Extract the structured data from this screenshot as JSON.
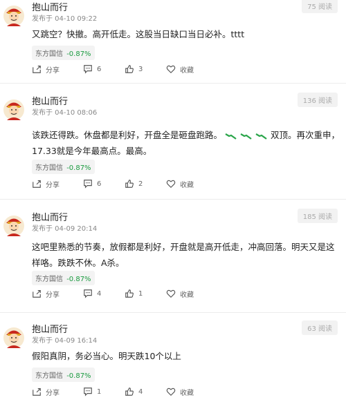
{
  "posts": [
    {
      "author": "抱山而行",
      "time": "发布于 04-10 09:22",
      "reads": "75 阅读",
      "content": "又跳空？快撤。高开低走。这股当日缺口当日必补。tttt",
      "stock_name": "东方国信",
      "stock_change": "-0.87%",
      "share": "分享",
      "comments": "6",
      "likes": "3",
      "fav": "收藏"
    },
    {
      "author": "抱山而行",
      "time": "发布于 04-10 08:06",
      "reads": "136 阅读",
      "content_a": "该跌还得跌。休盘都是利好，开盘全是砸盘跑路。",
      "content_b": "双顶。再次重申，17.33就是今年最高点。最高。",
      "stock_name": "东方国信",
      "stock_change": "-0.87%",
      "share": "分享",
      "comments": "6",
      "likes": "2",
      "fav": "收藏"
    },
    {
      "author": "抱山而行",
      "time": "发布于 04-09 20:14",
      "reads": "185 阅读",
      "content": "这吧里熟悉的节奏，放假都是利好，开盘就是高开低走，冲高回落。明天又是这样咯。跌跌不休。A杀。",
      "stock_name": "东方国信",
      "stock_change": "-0.87%",
      "share": "分享",
      "comments": "4",
      "likes": "1",
      "fav": "收藏"
    },
    {
      "author": "抱山而行",
      "time": "发布于 04-09 16:14",
      "reads": "63 阅读",
      "content": "假阳真阴，务必当心。明天跌10个以上",
      "stock_name": "东方国信",
      "stock_change": "-0.87%",
      "share": "分享",
      "comments": "1",
      "likes": "4",
      "fav": "收藏"
    }
  ],
  "colors": {
    "down": "#1a9a3f",
    "reads_bg": "#f2f2f2"
  },
  "icons": {
    "avatar": "cartoon-avatar",
    "share": "share-icon",
    "comment": "comment-icon",
    "like": "thumbs-up-icon",
    "fav": "heart-icon",
    "emoji": "falling-arrow-emoji"
  }
}
